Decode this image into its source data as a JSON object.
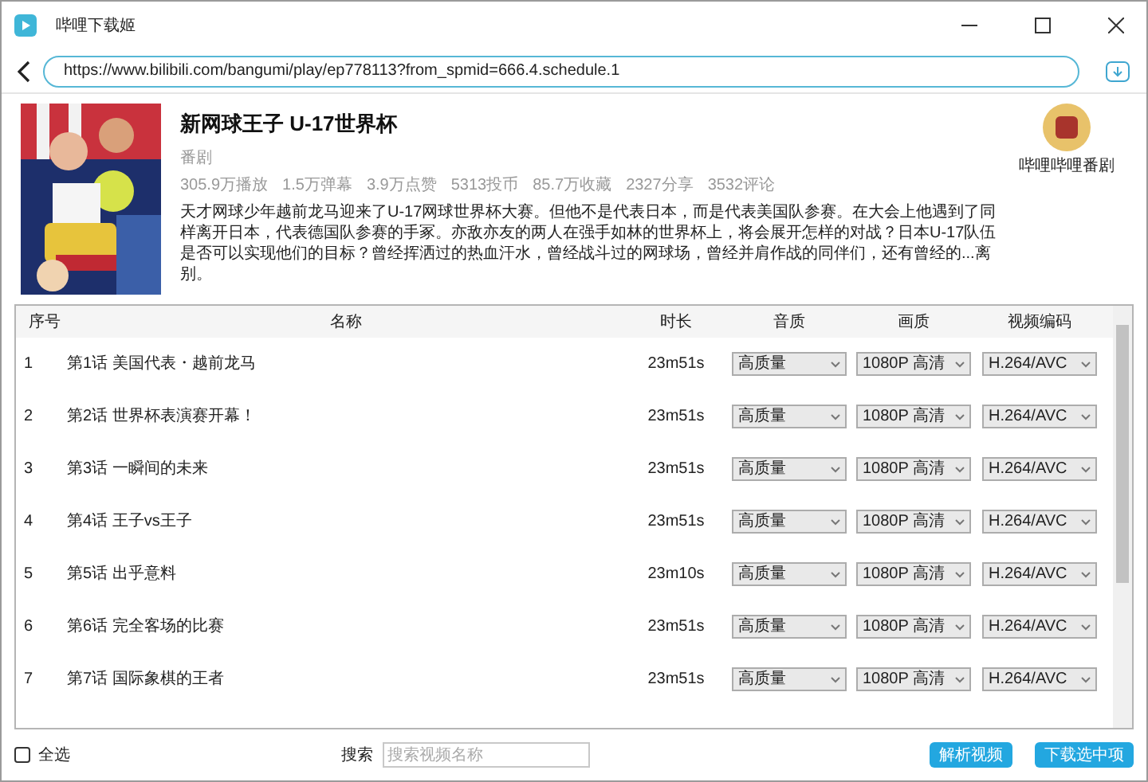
{
  "window": {
    "title": "哔哩下载姬"
  },
  "url_bar": {
    "value": "https://www.bilibili.com/bangumi/play/ep778113?from_spmid=666.4.schedule.1"
  },
  "info": {
    "title": "新网球王子 U-17世界杯",
    "type": "番剧",
    "stats": [
      "305.9万播放",
      "1.5万弹幕",
      "3.9万点赞",
      "5313投币",
      "85.7万收藏",
      "2327分享",
      "3532评论"
    ],
    "description": "天才网球少年越前龙马迎来了U-17网球世界杯大赛。但他不是代表日本，而是代表美国队参赛。在大会上他遇到了同样离开日本，代表德国队参赛的手冢。亦敌亦友的两人在强手如林的世界杯上，将会展开怎样的对战？日本U-17队伍是否可以实现他们的目标？曾经挥洒过的热血汗水，曾经战斗过的网球场，曾经并肩作战的同伴们，还有曾经的...离别。",
    "uploader": "哔哩哔哩番剧"
  },
  "table": {
    "columns": [
      "序号",
      "名称",
      "时长",
      "音质",
      "画质",
      "视频编码"
    ],
    "rows": [
      {
        "index": "1",
        "name": "第1话 美国代表・越前龙马",
        "duration": "23m51s",
        "audio": "高质量",
        "quality": "1080P 高清",
        "codec": "H.264/AVC"
      },
      {
        "index": "2",
        "name": "第2话 世界杯表演赛开幕！",
        "duration": "23m51s",
        "audio": "高质量",
        "quality": "1080P 高清",
        "codec": "H.264/AVC"
      },
      {
        "index": "3",
        "name": "第3话 一瞬间的未来",
        "duration": "23m51s",
        "audio": "高质量",
        "quality": "1080P 高清",
        "codec": "H.264/AVC"
      },
      {
        "index": "4",
        "name": "第4话 王子vs王子",
        "duration": "23m51s",
        "audio": "高质量",
        "quality": "1080P 高清",
        "codec": "H.264/AVC"
      },
      {
        "index": "5",
        "name": "第5话 出乎意料",
        "duration": "23m10s",
        "audio": "高质量",
        "quality": "1080P 高清",
        "codec": "H.264/AVC"
      },
      {
        "index": "6",
        "name": "第6话 完全客场的比赛",
        "duration": "23m51s",
        "audio": "高质量",
        "quality": "1080P 高清",
        "codec": "H.264/AVC"
      },
      {
        "index": "7",
        "name": "第7话 国际象棋的王者",
        "duration": "23m51s",
        "audio": "高质量",
        "quality": "1080P 高清",
        "codec": "H.264/AVC"
      }
    ]
  },
  "footer": {
    "select_all": {
      "label": "全选",
      "checked": false
    },
    "search_label": "搜索",
    "search": {
      "placeholder": "搜索视频名称"
    },
    "buttons": [
      "解析视频",
      "下载选中项"
    ]
  }
}
